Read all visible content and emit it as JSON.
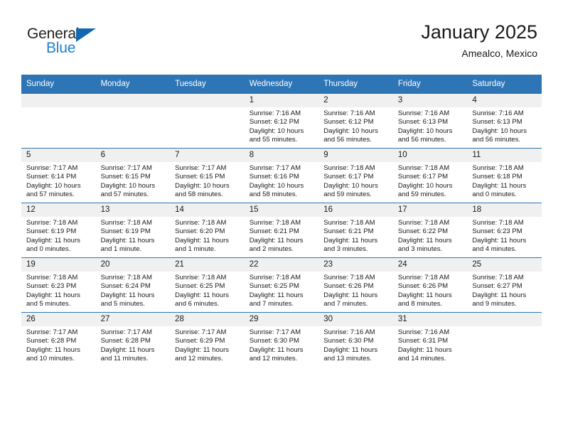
{
  "brand": {
    "name_part1": "General",
    "name_part2": "Blue",
    "triangle_icon": "triangle-right-icon",
    "color_dark": "#222222",
    "color_blue": "#1f7fd4",
    "color_triangle": "#1267b2"
  },
  "header": {
    "title": "January 2025",
    "subtitle": "Amealco, Mexico"
  },
  "theme": {
    "header_bg": "#2e75b6",
    "daynum_bg": "#f0f0f0",
    "cell_bg": "#ffffff",
    "text": "#1a1a1a"
  },
  "weekday_headers": [
    "Sunday",
    "Monday",
    "Tuesday",
    "Wednesday",
    "Thursday",
    "Friday",
    "Saturday"
  ],
  "weeks": [
    [
      {
        "day": "",
        "sunrise": "",
        "sunset": "",
        "daylight": ""
      },
      {
        "day": "",
        "sunrise": "",
        "sunset": "",
        "daylight": ""
      },
      {
        "day": "",
        "sunrise": "",
        "sunset": "",
        "daylight": ""
      },
      {
        "day": "1",
        "sunrise": "Sunrise: 7:16 AM",
        "sunset": "Sunset: 6:12 PM",
        "daylight": "Daylight: 10 hours and 55 minutes."
      },
      {
        "day": "2",
        "sunrise": "Sunrise: 7:16 AM",
        "sunset": "Sunset: 6:12 PM",
        "daylight": "Daylight: 10 hours and 56 minutes."
      },
      {
        "day": "3",
        "sunrise": "Sunrise: 7:16 AM",
        "sunset": "Sunset: 6:13 PM",
        "daylight": "Daylight: 10 hours and 56 minutes."
      },
      {
        "day": "4",
        "sunrise": "Sunrise: 7:16 AM",
        "sunset": "Sunset: 6:13 PM",
        "daylight": "Daylight: 10 hours and 56 minutes."
      }
    ],
    [
      {
        "day": "5",
        "sunrise": "Sunrise: 7:17 AM",
        "sunset": "Sunset: 6:14 PM",
        "daylight": "Daylight: 10 hours and 57 minutes."
      },
      {
        "day": "6",
        "sunrise": "Sunrise: 7:17 AM",
        "sunset": "Sunset: 6:15 PM",
        "daylight": "Daylight: 10 hours and 57 minutes."
      },
      {
        "day": "7",
        "sunrise": "Sunrise: 7:17 AM",
        "sunset": "Sunset: 6:15 PM",
        "daylight": "Daylight: 10 hours and 58 minutes."
      },
      {
        "day": "8",
        "sunrise": "Sunrise: 7:17 AM",
        "sunset": "Sunset: 6:16 PM",
        "daylight": "Daylight: 10 hours and 58 minutes."
      },
      {
        "day": "9",
        "sunrise": "Sunrise: 7:18 AM",
        "sunset": "Sunset: 6:17 PM",
        "daylight": "Daylight: 10 hours and 59 minutes."
      },
      {
        "day": "10",
        "sunrise": "Sunrise: 7:18 AM",
        "sunset": "Sunset: 6:17 PM",
        "daylight": "Daylight: 10 hours and 59 minutes."
      },
      {
        "day": "11",
        "sunrise": "Sunrise: 7:18 AM",
        "sunset": "Sunset: 6:18 PM",
        "daylight": "Daylight: 11 hours and 0 minutes."
      }
    ],
    [
      {
        "day": "12",
        "sunrise": "Sunrise: 7:18 AM",
        "sunset": "Sunset: 6:19 PM",
        "daylight": "Daylight: 11 hours and 0 minutes."
      },
      {
        "day": "13",
        "sunrise": "Sunrise: 7:18 AM",
        "sunset": "Sunset: 6:19 PM",
        "daylight": "Daylight: 11 hours and 1 minute."
      },
      {
        "day": "14",
        "sunrise": "Sunrise: 7:18 AM",
        "sunset": "Sunset: 6:20 PM",
        "daylight": "Daylight: 11 hours and 1 minute."
      },
      {
        "day": "15",
        "sunrise": "Sunrise: 7:18 AM",
        "sunset": "Sunset: 6:21 PM",
        "daylight": "Daylight: 11 hours and 2 minutes."
      },
      {
        "day": "16",
        "sunrise": "Sunrise: 7:18 AM",
        "sunset": "Sunset: 6:21 PM",
        "daylight": "Daylight: 11 hours and 3 minutes."
      },
      {
        "day": "17",
        "sunrise": "Sunrise: 7:18 AM",
        "sunset": "Sunset: 6:22 PM",
        "daylight": "Daylight: 11 hours and 3 minutes."
      },
      {
        "day": "18",
        "sunrise": "Sunrise: 7:18 AM",
        "sunset": "Sunset: 6:23 PM",
        "daylight": "Daylight: 11 hours and 4 minutes."
      }
    ],
    [
      {
        "day": "19",
        "sunrise": "Sunrise: 7:18 AM",
        "sunset": "Sunset: 6:23 PM",
        "daylight": "Daylight: 11 hours and 5 minutes."
      },
      {
        "day": "20",
        "sunrise": "Sunrise: 7:18 AM",
        "sunset": "Sunset: 6:24 PM",
        "daylight": "Daylight: 11 hours and 5 minutes."
      },
      {
        "day": "21",
        "sunrise": "Sunrise: 7:18 AM",
        "sunset": "Sunset: 6:25 PM",
        "daylight": "Daylight: 11 hours and 6 minutes."
      },
      {
        "day": "22",
        "sunrise": "Sunrise: 7:18 AM",
        "sunset": "Sunset: 6:25 PM",
        "daylight": "Daylight: 11 hours and 7 minutes."
      },
      {
        "day": "23",
        "sunrise": "Sunrise: 7:18 AM",
        "sunset": "Sunset: 6:26 PM",
        "daylight": "Daylight: 11 hours and 7 minutes."
      },
      {
        "day": "24",
        "sunrise": "Sunrise: 7:18 AM",
        "sunset": "Sunset: 6:26 PM",
        "daylight": "Daylight: 11 hours and 8 minutes."
      },
      {
        "day": "25",
        "sunrise": "Sunrise: 7:18 AM",
        "sunset": "Sunset: 6:27 PM",
        "daylight": "Daylight: 11 hours and 9 minutes."
      }
    ],
    [
      {
        "day": "26",
        "sunrise": "Sunrise: 7:17 AM",
        "sunset": "Sunset: 6:28 PM",
        "daylight": "Daylight: 11 hours and 10 minutes."
      },
      {
        "day": "27",
        "sunrise": "Sunrise: 7:17 AM",
        "sunset": "Sunset: 6:28 PM",
        "daylight": "Daylight: 11 hours and 11 minutes."
      },
      {
        "day": "28",
        "sunrise": "Sunrise: 7:17 AM",
        "sunset": "Sunset: 6:29 PM",
        "daylight": "Daylight: 11 hours and 12 minutes."
      },
      {
        "day": "29",
        "sunrise": "Sunrise: 7:17 AM",
        "sunset": "Sunset: 6:30 PM",
        "daylight": "Daylight: 11 hours and 12 minutes."
      },
      {
        "day": "30",
        "sunrise": "Sunrise: 7:16 AM",
        "sunset": "Sunset: 6:30 PM",
        "daylight": "Daylight: 11 hours and 13 minutes."
      },
      {
        "day": "31",
        "sunrise": "Sunrise: 7:16 AM",
        "sunset": "Sunset: 6:31 PM",
        "daylight": "Daylight: 11 hours and 14 minutes."
      },
      {
        "day": "",
        "sunrise": "",
        "sunset": "",
        "daylight": ""
      }
    ]
  ]
}
